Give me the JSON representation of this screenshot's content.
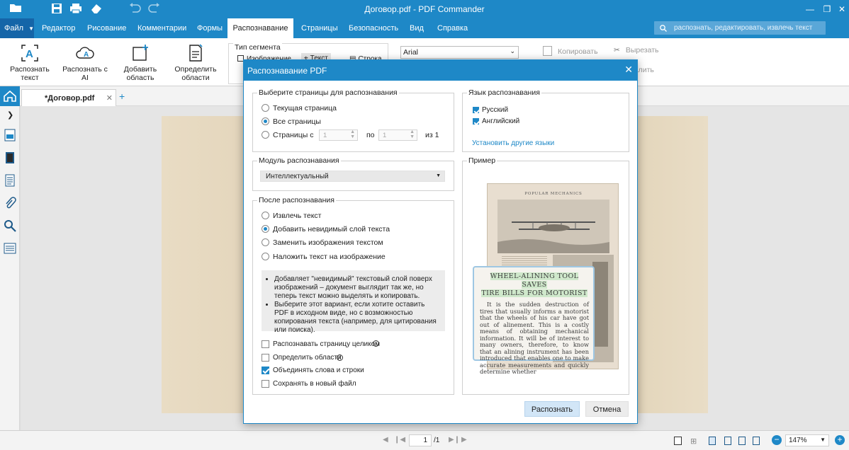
{
  "window": {
    "title": "Договор.pdf - PDF Commander"
  },
  "menu": {
    "file": "Файл",
    "items": [
      "Редактор",
      "Рисование",
      "Комментарии",
      "Формы",
      "Распознавание",
      "Страницы",
      "Безопасность",
      "Вид",
      "Справка"
    ],
    "active": "Распознавание",
    "search_placeholder": "распознать, редактировать, извлечь текст"
  },
  "ribbon": {
    "recognize_text": "Распознать текст",
    "recognize_ai": "Распознать с AI",
    "add_area": "Добавить область",
    "define_areas": "Определить области",
    "segment_type_label": "Тип сегмента",
    "segment_image": "Изображение",
    "segment_text": "Текст",
    "segment_line": "Строка",
    "font": "Arial",
    "copy": "Копировать",
    "cut": "Вырезать",
    "delete": "Удалить"
  },
  "tabs": {
    "doc": "*Договор.pdf",
    "add": "+"
  },
  "status": {
    "page_current": "1",
    "page_total": "/1",
    "zoom": "147%"
  },
  "dialog": {
    "title": "Распознавание PDF",
    "pages_group": "Выберите страницы для распознавания",
    "opt_current": "Текущая страница",
    "opt_all": "Все страницы",
    "opt_range": "Страницы с",
    "range_from": "1",
    "range_to_label": "по",
    "range_to": "1",
    "range_of": "из 1",
    "lang_group": "Язык распознавания",
    "lang_ru": "Русский",
    "lang_en": "Английский",
    "install_langs": "Установить другие языки",
    "module_group": "Модуль распознавания",
    "module_value": "Интеллектуальный",
    "sample_group": "Пример",
    "after_group": "После распознавания",
    "after_extract": "Извлечь текст",
    "after_invisible": "Добавить невидимый слой текста",
    "after_replace": "Заменить изображения текстом",
    "after_overlay": "Наложить текст на изображение",
    "info_1": "Добавляет \"невидимый\" текстовый слой поверх изображений – документ выглядит так же, но теперь текст можно выделять и копировать.",
    "info_2": "Выберите этот вариант, если хотите оставить PDF в исходном виде, но с возможностью копирования текста (например, для цитирования или поиска).",
    "chk_whole_page": "Распознавать страницу целиком",
    "chk_define_areas": "Определить области",
    "chk_merge": "Объединять слова и строки",
    "chk_new_file": "Сохранять в новый файл",
    "btn_recognize": "Распознать",
    "btn_cancel": "Отмена"
  },
  "sample": {
    "header": "POPULAR MECHANICS",
    "headline_1": "WHEEL-ALINING TOOL SAVES",
    "headline_2": "TIRE BILLS FOR MOTORIST",
    "body": "It is the sudden destruction of tires that usually informs a motorist that the wheels of his car have got out of alinement. This is a costly means of obtaining mechanical information. It will be of interest to many owners, therefore, to know that an alining instrument has been introduced that enables one to make accurate measurements and quickly determine whether"
  },
  "colors": {
    "accent": "#1e88c7"
  }
}
